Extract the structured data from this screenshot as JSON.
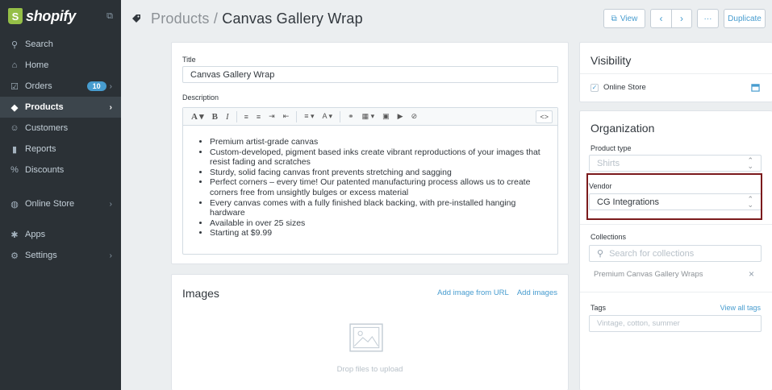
{
  "sidebar": {
    "brand": "shopify",
    "brand_badge": "S",
    "items": [
      {
        "label": "Search",
        "icon": "search-icon",
        "glyph": "⚲"
      },
      {
        "label": "Home",
        "icon": "home-icon",
        "glyph": "⌂"
      },
      {
        "label": "Orders",
        "icon": "orders-icon",
        "glyph": "☑",
        "badge": "10"
      },
      {
        "label": "Products",
        "icon": "products-icon",
        "glyph": "◆"
      },
      {
        "label": "Customers",
        "icon": "customers-icon",
        "glyph": "☺"
      },
      {
        "label": "Reports",
        "icon": "reports-icon",
        "glyph": "▮"
      },
      {
        "label": "Discounts",
        "icon": "discounts-icon",
        "glyph": "%"
      },
      {
        "label": "Online Store",
        "icon": "online-store-icon",
        "glyph": "◍"
      },
      {
        "label": "Apps",
        "icon": "apps-icon",
        "glyph": "✱"
      },
      {
        "label": "Settings",
        "icon": "settings-icon",
        "glyph": "⚙"
      }
    ]
  },
  "header": {
    "crumb": "Products",
    "separator": " / ",
    "title": "Canvas Gallery Wrap",
    "view_label": "View",
    "more_label": "···",
    "duplicate_label": "Duplicate"
  },
  "product": {
    "title_label": "Title",
    "title_value": "Canvas Gallery Wrap",
    "description_label": "Description",
    "toolbar": [
      "A ▾",
      "B",
      "I",
      "≡",
      "≡",
      "⇥",
      "⇤",
      "≡ ▾",
      "A ▾",
      "⚭",
      "▦ ▾",
      "▣",
      "▶",
      "⊘"
    ],
    "code_button": "<>",
    "bullets": [
      "Premium artist-grade canvas",
      "Custom-developed, pigment based inks create vibrant reproductions of your images that resist fading and scratches",
      "Sturdy, solid facing canvas front prevents stretching and sagging",
      "Perfect corners – every time! Our patented manufacturing process allows us to create corners free from unsightly bulges or excess material",
      "Every canvas comes with a fully finished black backing, with pre-installed hanging hardware",
      "Available in over 25 sizes",
      "Starting at $9.99"
    ]
  },
  "images": {
    "heading": "Images",
    "add_url": "Add image from URL",
    "add_images": "Add images",
    "drop_text": "Drop files to upload"
  },
  "visibility": {
    "heading": "Visibility",
    "channel": "Online Store"
  },
  "organization": {
    "heading": "Organization",
    "product_type_label": "Product type",
    "product_type_placeholder": "Shirts",
    "vendor_label": "Vendor",
    "vendor_value": "CG Integrations",
    "collections_label": "Collections",
    "collections_placeholder": "Search for collections",
    "collection_item": "Premium Canvas Gallery Wraps",
    "tags_label": "Tags",
    "view_all_tags": "View all tags",
    "tags_placeholder": "Vintage, cotton, summer"
  },
  "colors": {
    "sidebar_bg": "#2b3136",
    "accent": "#479ccf",
    "highlight_border": "#7b1a1c"
  }
}
